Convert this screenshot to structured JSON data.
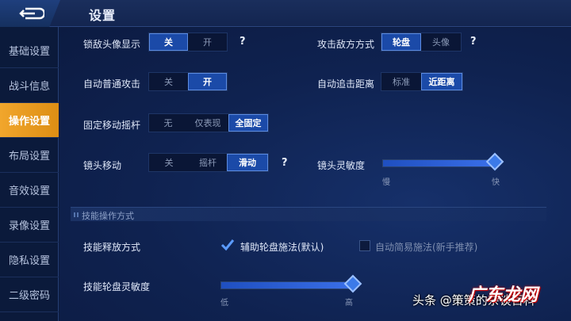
{
  "header": {
    "title": "设置"
  },
  "sidebar": {
    "items": [
      {
        "label": "基础设置",
        "active": false
      },
      {
        "label": "战斗信息",
        "active": false
      },
      {
        "label": "操作设置",
        "active": true
      },
      {
        "label": "布局设置",
        "active": false
      },
      {
        "label": "音效设置",
        "active": false
      },
      {
        "label": "录像设置",
        "active": false
      },
      {
        "label": "隐私设置",
        "active": false
      },
      {
        "label": "二级密码",
        "active": false
      }
    ]
  },
  "settings": {
    "lock_avatar": {
      "label": "锁敌头像显示",
      "options": [
        "关",
        "开"
      ],
      "selected": "关",
      "help": "?"
    },
    "attack_mode": {
      "label": "攻击敌方方式",
      "options": [
        "轮盘",
        "头像"
      ],
      "selected": "轮盘",
      "help": "?"
    },
    "auto_attack": {
      "label": "自动普通攻击",
      "options": [
        "关",
        "开"
      ],
      "selected": "开"
    },
    "chase_distance": {
      "label": "自动追击距离",
      "options": [
        "标准",
        "近距离"
      ],
      "selected": "近距离"
    },
    "fixed_joystick": {
      "label": "固定移动摇杆",
      "options": [
        "无",
        "仅表现",
        "全固定"
      ],
      "selected": "全固定"
    },
    "camera_move": {
      "label": "镜头移动",
      "options": [
        "关",
        "摇杆",
        "滑动"
      ],
      "selected": "滑动",
      "help": "?"
    },
    "camera_sensitivity": {
      "label": "镜头灵敏度",
      "min_label": "慢",
      "max_label": "快",
      "value": 1.0
    },
    "skill_section": {
      "title": "技能操作方式"
    },
    "skill_release": {
      "label": "技能释放方式",
      "option1": {
        "label": "辅助轮盘施法(默认)",
        "checked": true
      },
      "option2": {
        "label": "自动简易施法(新手推荐)",
        "checked": false
      }
    },
    "skill_wheel_sensitivity": {
      "label": "技能轮盘灵敏度",
      "min_label": "低",
      "max_label": "高",
      "value": 1.0
    }
  },
  "watermark": {
    "text": "头条 @策策的杂谈百科",
    "logo": "广东龙网"
  },
  "colors": {
    "accent_orange": "#f1a62c",
    "selected_blue": "#1b4aa8",
    "background": "#0d1c3f"
  }
}
